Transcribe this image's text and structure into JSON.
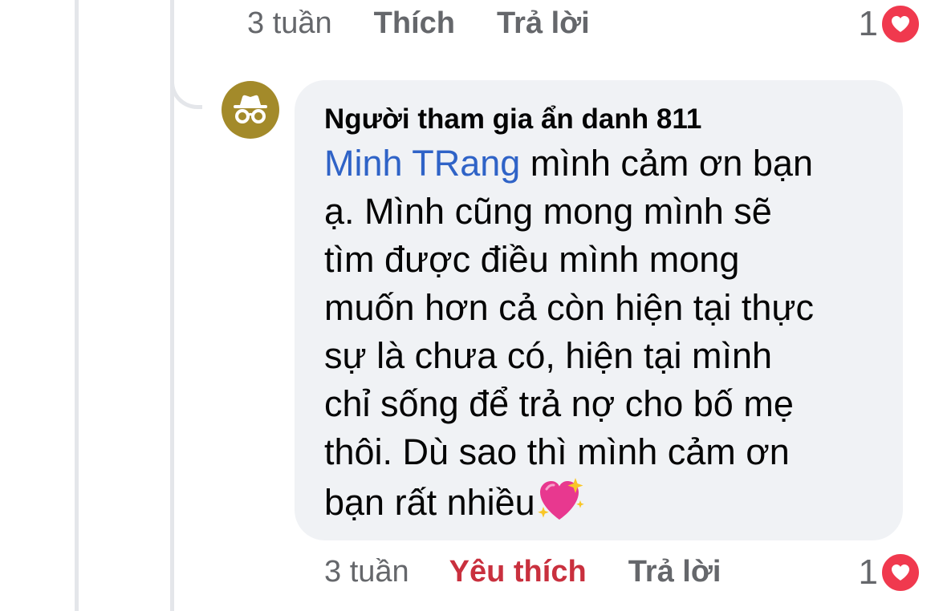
{
  "previous_comment": {
    "time": "3 tuần",
    "like_label": "Thích",
    "reply_label": "Trả lời",
    "reaction_count": "1",
    "reaction_icon": "heart-icon"
  },
  "comment": {
    "author": "Người tham gia ẩn danh 811",
    "avatar_icon": "anonymous-incognito-icon",
    "mention": "Minh TRang",
    "lines": [
      " mình cảm ơn bạn",
      "ạ. Mình cũng mong mình sẽ",
      "tìm được điều mình mong",
      "muốn hơn cả còn hiện tại thực",
      "sự là chưa có, hiện tại mình",
      "chỉ sống để trả nợ cho bố mẹ",
      "thôi. Dù sao thì mình cảm ơn",
      "bạn rất nhiều"
    ],
    "emoji": "sparkling-heart-emoji",
    "time": "3 tuần",
    "like_label": "Yêu thích",
    "reply_label": "Trả lời",
    "reaction_count": "1",
    "reaction_icon": "heart-icon"
  },
  "colors": {
    "mention": "#2f63c7",
    "liked": "#c9303e",
    "heart": "#f0394e",
    "bubble": "#f0f2f5",
    "avatar": "#a38a2a"
  }
}
